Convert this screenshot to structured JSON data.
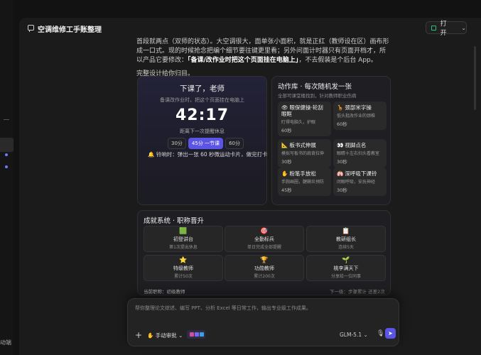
{
  "window": {
    "title": "空调维修工手账整理"
  },
  "header": {
    "open_label": "打开",
    "chevron": "⌄"
  },
  "left_rail": {
    "bottom_label": "动端"
  },
  "intro": {
    "line1": "首段就两点（双师的状态）。大空调很大，面单张小面积，就是正红（教师设在区）画布形成一口",
    "line2": "式。现的时候抢念把编个细节要往键更里看；另外问面计时器只有页面开档才，所以产品它要修改：",
    "emph": "「备课/改作业时把这个页面挂在电脑上」",
    "line3": "，不去假装是个后台 App。",
    "para2": "完整设计给你归目。"
  },
  "timer": {
    "title": "下课了，老师",
    "subtitle": "备课改作业时，把这个页面挂在电脑上",
    "clock": "42:17",
    "next": "距离下一次提醒休息",
    "options": [
      "30分",
      "45分 一节课",
      "60分"
    ],
    "bell_icon": "🔔",
    "bell_text": "铃响时：弹出一张 60 秒微运动卡片，做完打卡"
  },
  "actions": {
    "title": "动作库 · 每次随机发一张",
    "subtitle": "全部可课堂楼找到，针对教师职业伤病",
    "items": [
      {
        "icon": "👁",
        "name": "眼保健操·轮刮眼眶",
        "desc": "盯得电脑久，护眼",
        "dur": "60秒"
      },
      {
        "icon": "🦒",
        "name": "颈部米字操",
        "desc": "低头批改作业的颈椎",
        "dur": "60秒"
      },
      {
        "icon": "📐",
        "name": "板书式伸展",
        "desc": "模拟写板书的肩背拉伸",
        "dur": "30秒"
      },
      {
        "icon": "👀",
        "name": "视脚点名",
        "desc": "眼睛十左右扫头看教室",
        "dur": "30秒"
      },
      {
        "icon": "✋",
        "name": "粉笔手放松",
        "desc": "手腕画圈，腱鞘炎预防",
        "dur": "45秒"
      },
      {
        "icon": "🫁",
        "name": "深呼吸下课铃",
        "desc": "闭眼呼吸，安抚神经",
        "dur": "30秒"
      }
    ]
  },
  "achievements": {
    "title": "成就系统 · 职称晋升",
    "items": [
      {
        "icon": "🟩",
        "name": "初登讲台",
        "desc": "第1次提出休息"
      },
      {
        "icon": "🎯",
        "name": "全勤标兵",
        "desc": "单日完成全部提醒"
      },
      {
        "icon": "📋",
        "name": "教研组长",
        "desc": "连续5天"
      },
      {
        "icon": "⭐",
        "name": "特级教师",
        "desc": "累计50次"
      },
      {
        "icon": "🏆",
        "name": "功勋教师",
        "desc": "累计200次"
      },
      {
        "icon": "🌱",
        "name": "桃李满天下",
        "desc": "分享给一位同事"
      }
    ],
    "footer_left": "当前职称：初级教师",
    "footer_right": "下一级：步骤累计 还差2次"
  },
  "composer": {
    "placeholder": "帮你整理论文综述、编写 PPT、分析 Excel 等日常工作，输出专业级工作成果。",
    "plus": "+",
    "mode_label": "手动审批",
    "mode_chevron": "⌄",
    "model": "GLM-5.1 ⌄",
    "mic": "🎙",
    "send": "➤"
  },
  "colors": {
    "accent": "#5b55e6",
    "green": "#2ec277",
    "amber": "#f0b429"
  }
}
